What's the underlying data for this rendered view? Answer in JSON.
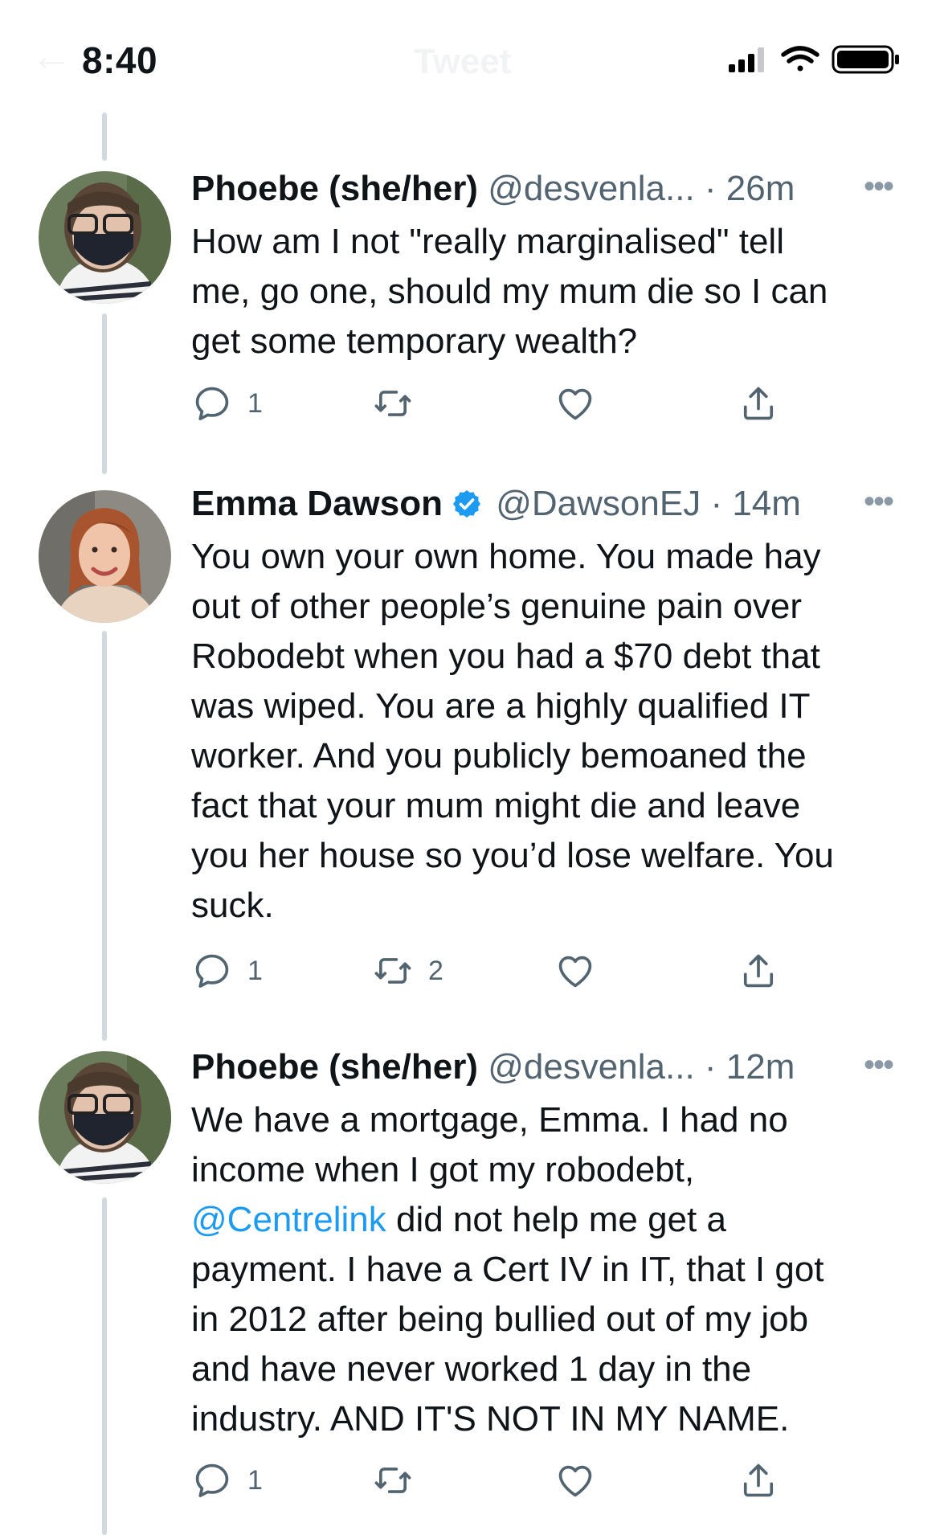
{
  "status_bar": {
    "time": "8:40",
    "ghost_title": "Tweet",
    "icons": [
      "back-arrow-icon",
      "signal-icon",
      "wifi-icon",
      "battery-icon"
    ]
  },
  "colors": {
    "text": "#0f1419",
    "secondary": "#536471",
    "link": "#1d9bf0",
    "verified": "#1d9bf0",
    "thread_line": "#cfd9de"
  },
  "tweets": [
    {
      "name": "Phoebe (she/her)",
      "handle": "@desvenla...",
      "separator": "·",
      "time": "26m",
      "verified": false,
      "avatar": "avatar-masked-glasses",
      "text": "How am I not \"really marginalised\" tell\nme, go one, should my mum die so I can\nget some temporary wealth?",
      "reply_count": "1",
      "retweet_count": "",
      "like_count": ""
    },
    {
      "name": "Emma Dawson",
      "handle": "@DawsonEJ",
      "separator": "·",
      "time": "14m",
      "verified": true,
      "avatar": "avatar-smiling-woman",
      "text": "You own your own home. You made hay\nout of other people’s genuine pain over\nRobodebt when you had a $70 debt that\nwas wiped. You are a highly qualified IT\nworker. And you publicly bemoaned the\nfact that your mum might die and leave\nyou her house so you’d lose welfare. You\nsuck.",
      "reply_count": "1",
      "retweet_count": "2",
      "like_count": ""
    },
    {
      "name": "Phoebe (she/her)",
      "handle": "@desvenla...",
      "separator": "·",
      "time": "12m",
      "verified": false,
      "avatar": "avatar-masked-glasses",
      "text_before_mention": "We have a mortgage, Emma. I had no\nincome when I got my robodebt,\n",
      "mention": "@Centrelink",
      "text_after_mention": " did not help me get a\npayment. I have a Cert IV in IT, that I got\nin 2012 after being bullied out of my job\nand have never worked 1 day in the\nindustry. AND IT'S NOT IN MY NAME.",
      "reply_count": "1",
      "retweet_count": "",
      "like_count": ""
    }
  ]
}
